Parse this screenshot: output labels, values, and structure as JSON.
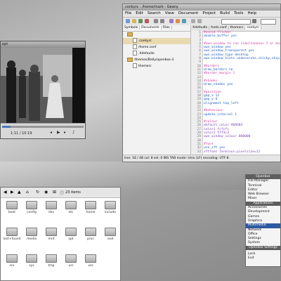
{
  "player": {
    "title": "ept",
    "time": "1:11 / 10:19",
    "progress": 0.1
  },
  "geany": {
    "title": "conkyrc - /home/mark - Geany",
    "menu": [
      "File",
      "Edit",
      "Search",
      "View",
      "Document",
      "Project",
      "Build",
      "Tools",
      "Help"
    ],
    "side_tabs": [
      "Symbols",
      "Documents",
      "Files"
    ],
    "tree": [
      {
        "label": "",
        "type": "folder",
        "indent": 0
      },
      {
        "label": ".conkyrc",
        "type": "file",
        "indent": 1,
        "selected": true
      },
      {
        "label": "/home.conf",
        "type": "file",
        "indent": 1
      },
      {
        "label": ".Xdefaults",
        "type": "file",
        "indent": 1
      },
      {
        "label": "/themes/Bally/openbox-3",
        "type": "folder",
        "indent": 0
      },
      {
        "label": "themerc",
        "type": "file",
        "indent": 1
      }
    ],
    "code_tabs": [
      "Xdefaults",
      "fonts.conf",
      "themerc",
      "conkyrc"
    ],
    "lines": [
      {
        "n": "1",
        "text": "#avoid flicker",
        "kind": "comment"
      },
      {
        "n": "2",
        "text": "double_buffer yes",
        "kind": "keyword"
      },
      {
        "n": "3",
        "text": "",
        "kind": "keyword"
      },
      {
        "n": "4",
        "text": "#own window to run simultaneous 2 or more conkys",
        "kind": "comment"
      },
      {
        "n": "5",
        "text": "own_window  yes",
        "kind": "keyword"
      },
      {
        "n": "6",
        "text": "own_window_transparent yes",
        "kind": "keyword"
      },
      {
        "n": "7",
        "text": "own_window_type desktop",
        "kind": "keyword"
      },
      {
        "n": "8",
        "text": "own_window_hints undecorate,sticky,skip_taskbar",
        "kind": "keyword"
      },
      {
        "n": "9",
        "text": "",
        "kind": "keyword"
      },
      {
        "n": "10",
        "text": "#borders",
        "kind": "comment"
      },
      {
        "n": "11",
        "text": "draw_borders no",
        "kind": "keyword"
      },
      {
        "n": "12",
        "text": "#border_margin 1",
        "kind": "comment"
      },
      {
        "n": "13",
        "text": "",
        "kind": "keyword"
      },
      {
        "n": "14",
        "text": "#shades",
        "kind": "comment"
      },
      {
        "n": "15",
        "text": "draw_shades yes",
        "kind": "keyword"
      },
      {
        "n": "16",
        "text": "",
        "kind": "keyword"
      },
      {
        "n": "17",
        "text": "#position",
        "kind": "comment"
      },
      {
        "n": "18",
        "text": "gap_x 12",
        "kind": "keyword"
      },
      {
        "n": "19",
        "text": "gap_y 6",
        "kind": "keyword"
      },
      {
        "n": "20",
        "text": "alignment top_left",
        "kind": "keyword"
      },
      {
        "n": "21",
        "text": "",
        "kind": "keyword"
      },
      {
        "n": "22",
        "text": "#behaviour",
        "kind": "comment"
      },
      {
        "n": "23",
        "text": "update_interval 1",
        "kind": "keyword"
      },
      {
        "n": "24",
        "text": "",
        "kind": "keyword"
      },
      {
        "n": "25",
        "text": "#colour",
        "kind": "comment"
      },
      {
        "n": "26",
        "text": "default_color  #8A6B3",
        "kind": "value"
      },
      {
        "n": "27",
        "text": "color1  fcfcfc",
        "kind": "value"
      },
      {
        "n": "28",
        "text": "color2  57f3c3",
        "kind": "value"
      },
      {
        "n": "29",
        "text": "own_window_colour 000000",
        "kind": "value"
      },
      {
        "n": "30",
        "text": "",
        "kind": "keyword"
      },
      {
        "n": "31",
        "text": "#font",
        "kind": "comment"
      },
      {
        "n": "32",
        "text": "use_xft yes",
        "kind": "keyword"
      },
      {
        "n": "33",
        "text": "xftfont Terminus:pixelsize=12",
        "kind": "value"
      }
    ],
    "status": "line: 18 / 48    col: 8    sel: 0    INS    TAB    mode: Unix (LF)    encoding: UTF-8"
  },
  "fm": {
    "items_count": "23 items",
    "items": [
      {
        "label": "boot"
      },
      {
        "label": "config"
      },
      {
        "label": "dev"
      },
      {
        "label": "etc"
      },
      {
        "label": "home"
      },
      {
        "label": "include"
      },
      {
        "label": "lost+found"
      },
      {
        "label": "media"
      },
      {
        "label": "mnt"
      },
      {
        "label": "opt"
      },
      {
        "label": "proc"
      },
      {
        "label": "root"
      },
      {
        "label": "srv"
      },
      {
        "label": "sys"
      },
      {
        "label": "tmp"
      },
      {
        "label": "usr"
      },
      {
        "label": "var"
      }
    ]
  },
  "menu": {
    "items": [
      {
        "label": "Openbox",
        "kind": "header"
      },
      {
        "label": "File Manager"
      },
      {
        "label": "Terminal"
      },
      {
        "label": "Editor"
      },
      {
        "label": "Web Browser"
      },
      {
        "label": "Mixer"
      },
      {
        "label": "Applications",
        "kind": "header"
      },
      {
        "label": "Accessories"
      },
      {
        "label": "Development"
      },
      {
        "label": "Games"
      },
      {
        "label": "Graphics"
      },
      {
        "label": "Multimedia",
        "kind": "sel"
      },
      {
        "label": "Network"
      },
      {
        "label": "Office"
      },
      {
        "label": "Settings"
      },
      {
        "label": "System"
      },
      {
        "label": "Openbox Settings",
        "kind": "header"
      },
      {
        "label": "",
        "kind": "sep"
      },
      {
        "label": "Lock"
      },
      {
        "label": "Exit"
      }
    ]
  }
}
